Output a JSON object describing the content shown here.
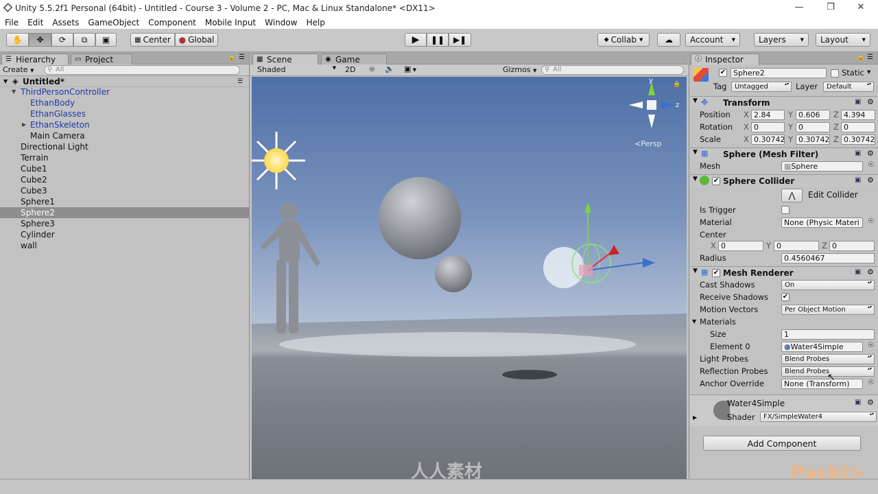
{
  "window": {
    "title": "Unity 5.5.2f1 Personal (64bit) - Untitled - Course 3 - Volume 2 - PC, Mac & Linux Standalone* <DX11>"
  },
  "menu": [
    "File",
    "Edit",
    "Assets",
    "GameObject",
    "Component",
    "Mobile Input",
    "Window",
    "Help"
  ],
  "toolbar": {
    "pivot": "Center",
    "space": "Global",
    "collab": "Collab",
    "account": "Account",
    "layers": "Layers",
    "layout": "Layout"
  },
  "hierarchy": {
    "tab": "Hierarchy",
    "project_tab": "Project",
    "create": "Create",
    "search_placeholder": "All",
    "scene": "Untitled*",
    "items": [
      {
        "label": "ThirdPersonController"
      },
      {
        "label": "EthanBody"
      },
      {
        "label": "EthanGlasses"
      },
      {
        "label": "EthanSkeleton"
      },
      {
        "label": "Main Camera"
      },
      {
        "label": "Directional Light"
      },
      {
        "label": "Terrain"
      },
      {
        "label": "Cube1"
      },
      {
        "label": "Cube2"
      },
      {
        "label": "Cube3"
      },
      {
        "label": "Sphere1"
      },
      {
        "label": "Sphere2"
      },
      {
        "label": "Sphere3"
      },
      {
        "label": "Cylinder"
      },
      {
        "label": "wall"
      }
    ]
  },
  "scene": {
    "tab": "Scene",
    "game_tab": "Game",
    "shading": "Shaded",
    "mode2d": "2D",
    "gizmos": "Gizmos",
    "search_placeholder": "All",
    "persp": "Persp",
    "gizmo_y": "y",
    "gizmo_z": "z"
  },
  "inspector": {
    "tab": "Inspector",
    "name": "Sphere2",
    "static": "Static",
    "tag_label": "Tag",
    "tag": "Untagged",
    "layer_label": "Layer",
    "layer": "Default",
    "transform": {
      "title": "Transform",
      "position_label": "Position",
      "rotation_label": "Rotation",
      "scale_label": "Scale",
      "position": {
        "x": "2.84",
        "y": "0.606",
        "z": "4.394"
      },
      "rotation": {
        "x": "0",
        "y": "0",
        "z": "0"
      },
      "scale": {
        "x": "0.30742",
        "y": "0.30742",
        "z": "0.30742"
      }
    },
    "mesh_filter": {
      "title": "Sphere (Mesh Filter)",
      "mesh_label": "Mesh",
      "mesh": "Sphere"
    },
    "collider": {
      "title": "Sphere Collider",
      "edit": "Edit Collider",
      "is_trigger": "Is Trigger",
      "material_label": "Material",
      "material": "None (Physic Materi",
      "center_label": "Center",
      "center": {
        "x": "0",
        "y": "0",
        "z": "0"
      },
      "radius_label": "Radius",
      "radius": "0.4560467"
    },
    "renderer": {
      "title": "Mesh Renderer",
      "cast_shadows_label": "Cast Shadows",
      "cast_shadows": "On",
      "receive_shadows_label": "Receive Shadows",
      "motion_vectors_label": "Motion Vectors",
      "motion_vectors": "Per Object Motion",
      "materials_label": "Materials",
      "size_label": "Size",
      "size": "1",
      "element0_label": "Element 0",
      "element0": "Water4Simple",
      "light_probes_label": "Light Probes",
      "light_probes": "Blend Probes",
      "reflection_probes_label": "Reflection Probes",
      "reflection_probes": "Blend Probes",
      "anchor_label": "Anchor Override",
      "anchor": "None (Transform)"
    },
    "material": {
      "name": "Water4Simple",
      "shader_label": "Shader",
      "shader": "FX/SimpleWater4"
    },
    "add_component": "Add Component"
  },
  "axis": {
    "x": "X",
    "y": "Y",
    "z": "Z"
  },
  "watermark": {
    "center": "人人素材",
    "corner": "Packt>"
  }
}
